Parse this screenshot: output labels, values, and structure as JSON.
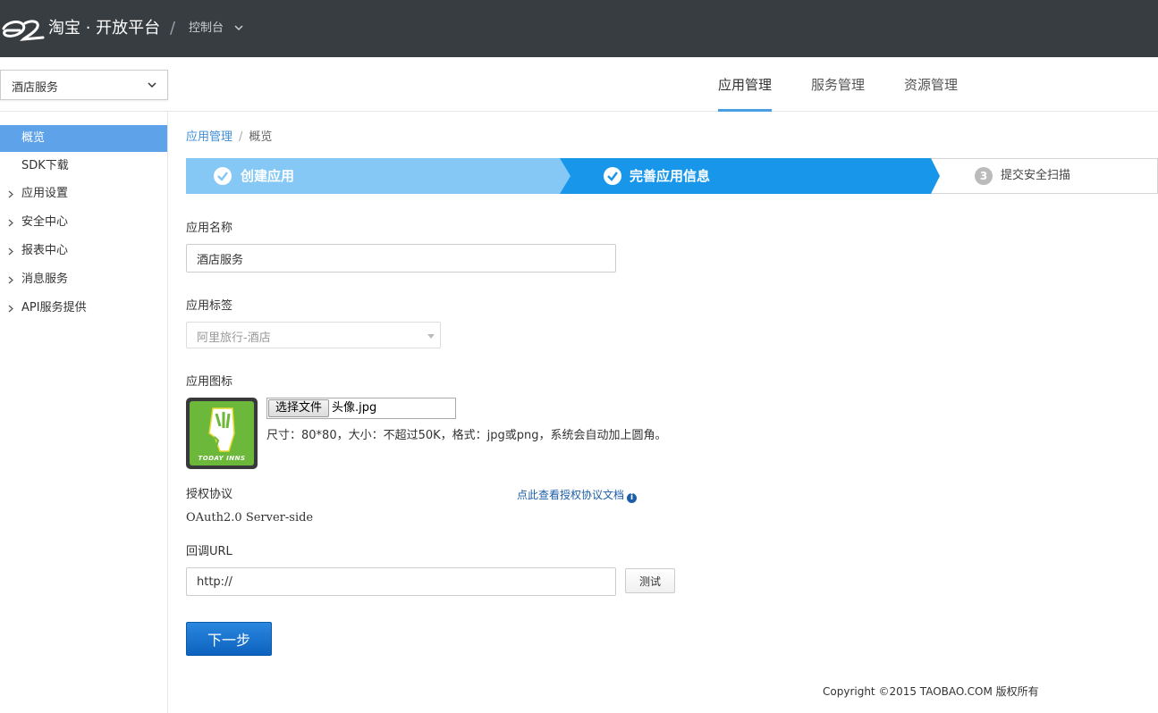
{
  "header": {
    "brand": "淘宝 · 开放平台",
    "separator": "/",
    "console_label": "控制台"
  },
  "app_selector": {
    "value": "酒店服务"
  },
  "nav_tabs": [
    {
      "label": "应用管理",
      "active": true
    },
    {
      "label": "服务管理",
      "active": false
    },
    {
      "label": "资源管理",
      "active": false
    }
  ],
  "sidebar": {
    "items": [
      {
        "label": "概览",
        "active": true,
        "expandable": false
      },
      {
        "label": "SDK下载",
        "active": false,
        "expandable": false
      },
      {
        "label": "应用设置",
        "active": false,
        "expandable": true
      },
      {
        "label": "安全中心",
        "active": false,
        "expandable": true
      },
      {
        "label": "报表中心",
        "active": false,
        "expandable": true
      },
      {
        "label": "消息服务",
        "active": false,
        "expandable": true
      },
      {
        "label": "API服务提供",
        "active": false,
        "expandable": true
      }
    ]
  },
  "breadcrumb": {
    "parent": "应用管理",
    "separator": "/",
    "current": "概览"
  },
  "steps": [
    {
      "label": "创建应用",
      "status": "done"
    },
    {
      "label": "完善应用信息",
      "status": "current"
    },
    {
      "number": "3",
      "label": "提交安全扫描",
      "status": "pending"
    }
  ],
  "form": {
    "app_name": {
      "label": "应用名称",
      "value": "酒店服务"
    },
    "app_tag": {
      "label": "应用标签",
      "value": "阿里旅行-酒店"
    },
    "app_icon": {
      "label": "应用图标",
      "file_button": "选择文件",
      "file_name": "头像.jpg",
      "hint": "尺寸：80*80，大小：不超过50K，格式：jpg或png，系统会自动加上圆角。",
      "logo_text": "TODAY INNS"
    },
    "auth": {
      "label": "授权协议",
      "doc_link": "点此查看授权协议文档",
      "value": "OAuth2.0 Server-side"
    },
    "callback": {
      "label": "回调URL",
      "value": "http://",
      "test_button": "测试"
    },
    "next_button": "下一步"
  },
  "footer": {
    "text": "Copyright ©2015 TAOBAO.COM 版权所有"
  },
  "colors": {
    "topbar": "#373d41",
    "step_done": "#86c8f5",
    "step_current": "#1796ea",
    "primary": "#0d62bf",
    "sidebar_active": "#5ea2e9"
  }
}
